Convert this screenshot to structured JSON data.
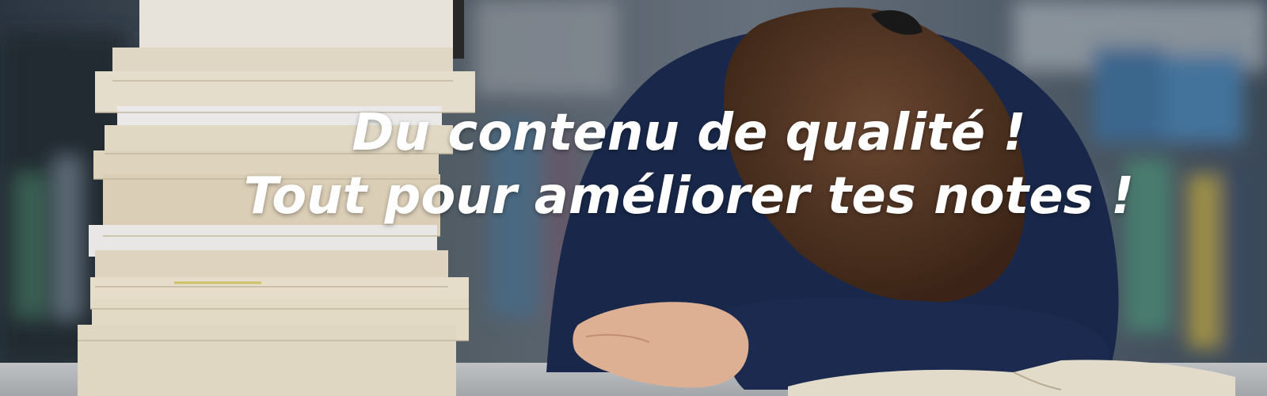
{
  "banner": {
    "headline_line1": "Du contenu de qualité !",
    "headline_line2": "Tout pour améliorer tes notes !",
    "colors": {
      "text": "#ffffff",
      "sweater": "#1b2a4e",
      "hair": "#5a3a28",
      "book_pages": "#ece4d3",
      "table": "#b9bdc1"
    }
  }
}
